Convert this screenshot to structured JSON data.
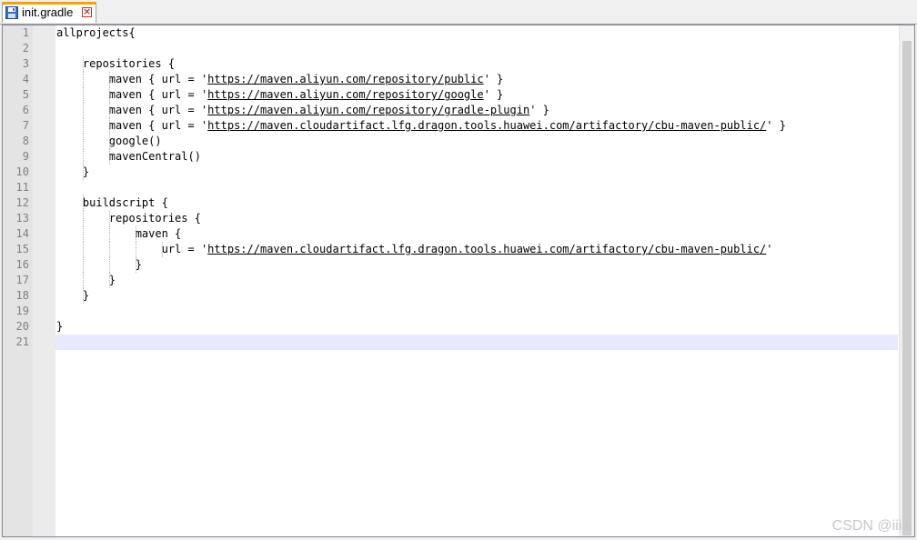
{
  "tab": {
    "title": "init.gradle",
    "icon": "save-icon",
    "close_icon": "close-icon",
    "accent_color": "#fa9c1b"
  },
  "editor": {
    "current_line": 21,
    "lines": [
      {
        "n": "1",
        "text": "allprojects{"
      },
      {
        "n": "2",
        "text": ""
      },
      {
        "n": "3",
        "text": "    repositories {"
      },
      {
        "n": "4",
        "pre": "        maven { url = '",
        "url": "https://maven.aliyun.com/repository/public",
        "post": "' }"
      },
      {
        "n": "5",
        "pre": "        maven { url = '",
        "url": "https://maven.aliyun.com/repository/google",
        "post": "' }"
      },
      {
        "n": "6",
        "pre": "        maven { url = '",
        "url": "https://maven.aliyun.com/repository/gradle-plugin",
        "post": "' }"
      },
      {
        "n": "7",
        "pre": "        maven { url = '",
        "url": "https://maven.cloudartifact.lfg.dragon.tools.huawei.com/artifactory/cbu-maven-public/",
        "post": "' }"
      },
      {
        "n": "8",
        "text": "        google()"
      },
      {
        "n": "9",
        "text": "        mavenCentral()"
      },
      {
        "n": "10",
        "text": "    }"
      },
      {
        "n": "11",
        "text": ""
      },
      {
        "n": "12",
        "text": "    buildscript {"
      },
      {
        "n": "13",
        "text": "        repositories {"
      },
      {
        "n": "14",
        "text": "            maven {"
      },
      {
        "n": "15",
        "pre": "                url = '",
        "url": "https://maven.cloudartifact.lfg.dragon.tools.huawei.com/artifactory/cbu-maven-public/",
        "post": "'"
      },
      {
        "n": "16",
        "text": "            }"
      },
      {
        "n": "17",
        "text": "        }"
      },
      {
        "n": "18",
        "text": "    }"
      },
      {
        "n": "19",
        "text": ""
      },
      {
        "n": "20",
        "text": "}"
      },
      {
        "n": "21",
        "text": ""
      }
    ]
  },
  "watermark": "CSDN @iiiiii"
}
